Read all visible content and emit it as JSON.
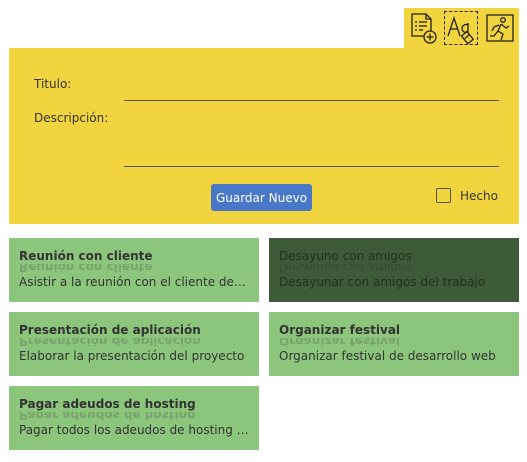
{
  "toolbar": {
    "icons": [
      "checklist-add-icon",
      "text-style-icon",
      "exit-run-icon"
    ]
  },
  "form": {
    "titulo_label": "Titulo:",
    "titulo_value": "",
    "descripcion_label": "Descripción:",
    "descripcion_value": "",
    "save_label": "Guardar Nuevo",
    "done_label": "Hecho",
    "done_checked": false
  },
  "colors": {
    "panel": "#f2d43f",
    "card": "#8cc57c",
    "card_selected": "#3e5b39",
    "button": "#4a78c9"
  },
  "cards": [
    {
      "title": "Reunión con cliente",
      "desc": "Asistir a la reunión con el cliente de desa...",
      "selected": false
    },
    {
      "title": "Desayuno con amigos",
      "desc": "Desayunar con amigos del trabajo",
      "selected": true
    },
    {
      "title": "Presentación de aplicación",
      "desc": "Elaborar la presentación del proyecto",
      "selected": false
    },
    {
      "title": "Organizar festival",
      "desc": "Organizar festival de desarrollo web",
      "selected": false
    },
    {
      "title": "Pagar adeudos de hosting",
      "desc": "Pagar todos los adeudos de hosting atra...",
      "selected": false
    }
  ]
}
